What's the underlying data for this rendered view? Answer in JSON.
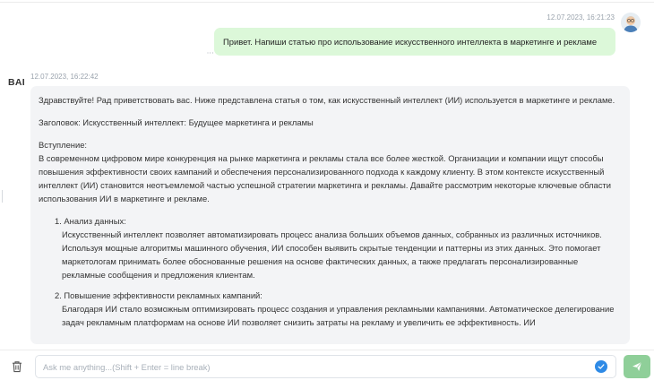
{
  "user_message": {
    "timestamp": "12.07.2023, 16:21:23",
    "text": "Привет. Напиши статью про использование искусственного интеллекта в маркетинге и рекламе"
  },
  "bot_message": {
    "logo": "BAI",
    "timestamp": "12.07.2023, 16:22:42",
    "intro": "Здравствуйте! Рад приветствовать вас. Ниже представлена статья о том, как искусственный интеллект (ИИ) используется в маркетинге и рекламе.",
    "heading": "Заголовок: Искусственный интеллект: Будущее маркетинга и рекламы",
    "section_title": "Вступление:",
    "section_text": "В современном цифровом мире конкуренция на рынке маркетинга и рекламы стала все более жесткой. Организации и компании ищут способы повышения эффективности своих кампаний и обеспечения персонализированного подхода к каждому клиенту. В этом контексте искусственный интеллект (ИИ) становится неотъемлемой частью успешной стратегии маркетинга и рекламы. Давайте рассмотрим некоторые ключевые области использования ИИ в маркетинге и рекламе.",
    "items": [
      {
        "title": "1. Анализ данных:",
        "text": "Искусственный интеллект позволяет автоматизировать процесс анализа больших объемов данных, собранных из различных источников. Используя мощные алгоритмы машинного обучения, ИИ способен выявить скрытые тенденции и паттерны из этих данных. Это помогает маркетологам принимать более обоснованные решения на основе фактических данных, а также предлагать персонализированные рекламные сообщения и предложения клиентам."
      },
      {
        "title": "2. Повышение эффективности рекламных кампаний:",
        "text": "Благодаря ИИ стало возможным оптимизировать процесс создания и управления рекламными кампаниями. Автоматическое делегирование задач рекламным платформам на основе ИИ позволяет снизить затраты на рекламу и увеличить ее эффективность. ИИ"
      }
    ]
  },
  "composer": {
    "placeholder": "Ask me anything...(Shift + Enter = line break)",
    "value": ""
  },
  "colors": {
    "user_bubble": "#dcf8d9",
    "bot_bubble": "#f3f4f6",
    "send_button": "#8fcf99",
    "check_icon": "#2e8ae6"
  }
}
